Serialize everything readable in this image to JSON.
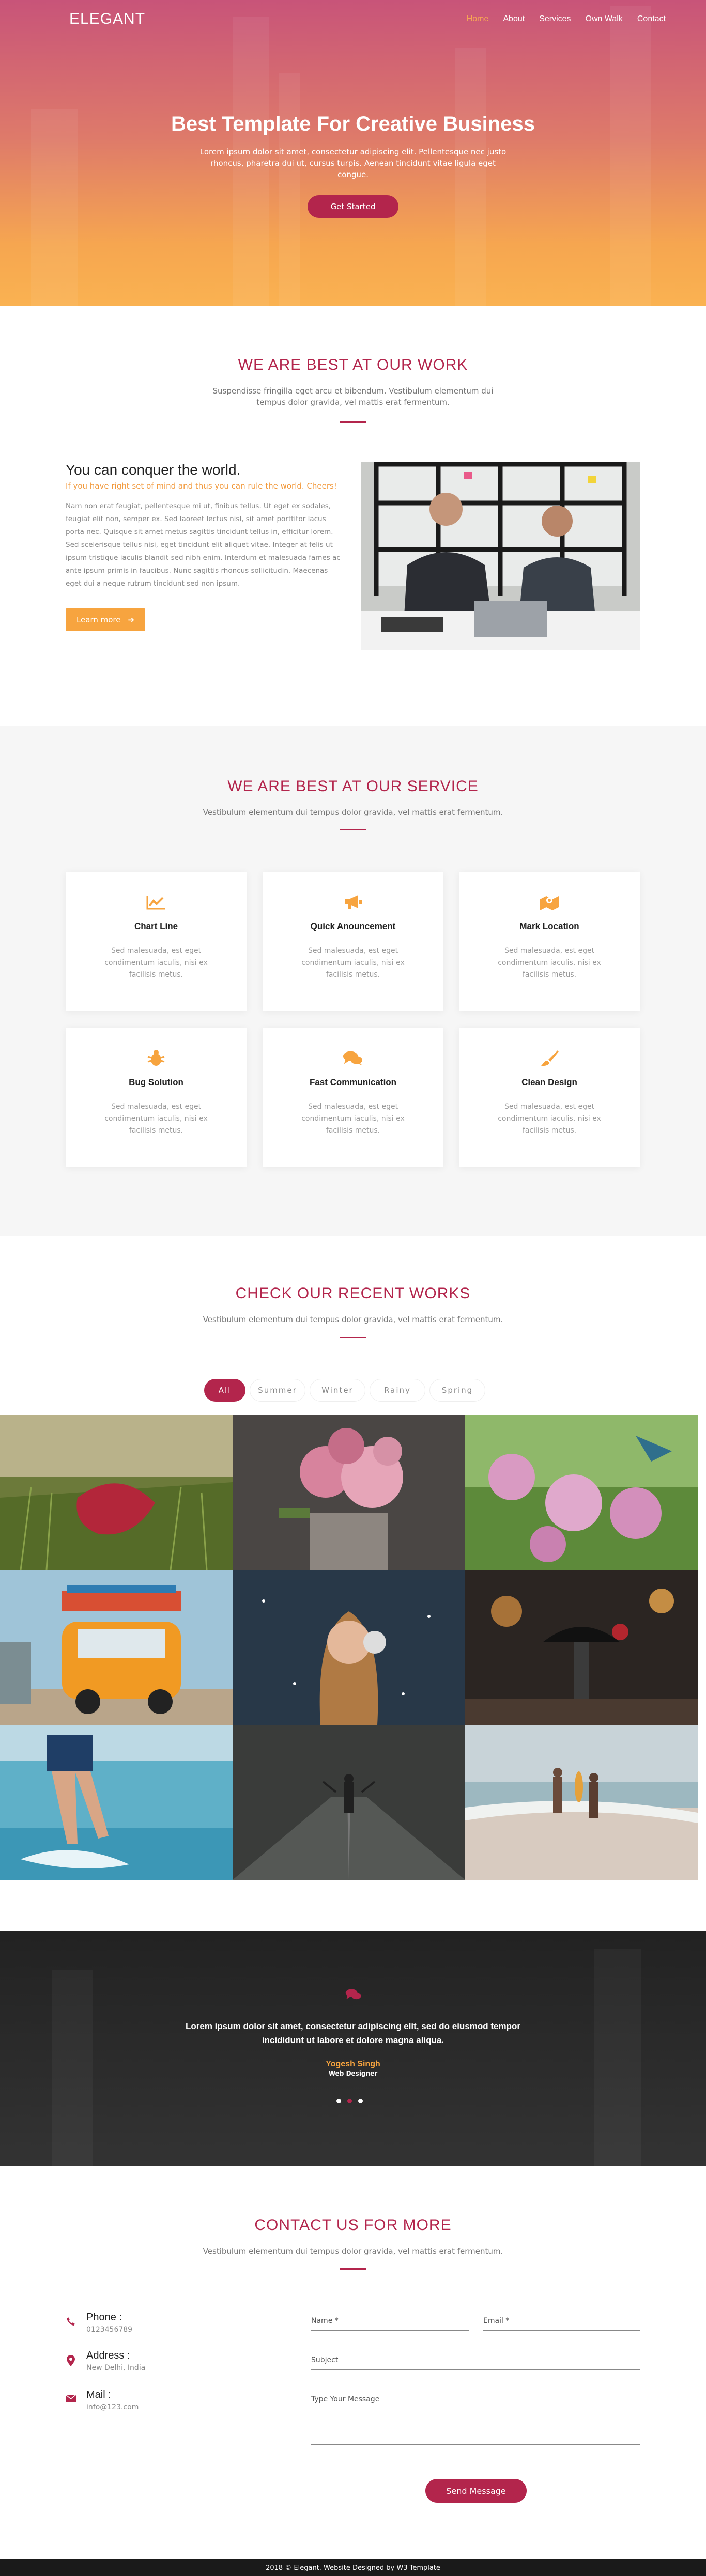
{
  "header": {
    "logo": "ELEGANT",
    "nav": [
      "Home",
      "About",
      "Services",
      "Own Walk",
      "Contact"
    ]
  },
  "hero": {
    "title": "Best Template For Creative Business",
    "text": "Lorem ipsum dolor sit amet, consectetur adipiscing elit. Pellentesque nec justo rhoncus, pharetra dui ut, cursus turpis. Aenean tincidunt vitae ligula eget congue.",
    "button": "Get Started"
  },
  "about": {
    "title": "WE ARE BEST AT OUR WORK",
    "subtitle": "Suspendisse fringilla eget arcu et bibendum. Vestibulum elementum dui tempus dolor gravida, vel mattis erat fermentum.",
    "heading": "You can conquer the world.",
    "tagline": "If you have right set of mind and thus you can rule the world. Cheers!",
    "text": "Nam non erat feugiat, pellentesque mi ut, finibus tellus. Ut eget ex sodales, feugiat elit non, semper ex. Sed laoreet lectus nisl, sit amet porttitor lacus porta nec. Quisque sit amet metus sagittis tincidunt tellus in, efficitur lorem. Sed scelerisque tellus nisi, eget tincidunt elit aliquet vitae. Integer at felis ut ipsum tristique iaculis blandit sed nibh enim. Interdum et malesuada fames ac ante ipsum primis in faucibus. Nunc sagittis rhoncus sollicitudin. Maecenas eget dui a neque rutrum tincidunt sed non ipsum.",
    "button": "Learn more"
  },
  "services": {
    "title": "WE ARE BEST AT OUR SERVICE",
    "subtitle": "Vestibulum elementum dui tempus dolor gravida, vel mattis erat fermentum.",
    "items": [
      {
        "title": "Chart Line",
        "text": "Sed malesuada, est eget condimentum iaculis, nisi ex facilisis metus.",
        "icon": "chart-line-icon"
      },
      {
        "title": "Quick Anouncement",
        "text": "Sed malesuada, est eget condimentum iaculis, nisi ex facilisis metus.",
        "icon": "bullhorn-icon"
      },
      {
        "title": "Mark Location",
        "text": "Sed malesuada, est eget condimentum iaculis, nisi ex facilisis metus.",
        "icon": "map-icon"
      },
      {
        "title": "Bug Solution",
        "text": "Sed malesuada, est eget condimentum iaculis, nisi ex facilisis metus.",
        "icon": "bug-icon"
      },
      {
        "title": "Fast Communication",
        "text": "Sed malesuada, est eget condimentum iaculis, nisi ex facilisis metus.",
        "icon": "comments-icon"
      },
      {
        "title": "Clean Design",
        "text": "Sed malesuada, est eget condimentum iaculis, nisi ex facilisis metus.",
        "icon": "paint-brush-icon"
      }
    ]
  },
  "works": {
    "title": "CHECK OUR RECENT WORKS",
    "subtitle": "Vestibulum elementum dui tempus dolor gravida, vel mattis erat fermentum.",
    "filters": [
      "All",
      "Summer",
      "Winter",
      "Rainy",
      "Spring"
    ]
  },
  "testimonial": {
    "quote": "Lorem ipsum dolor sit amet, consectetur adipiscing elit, sed do eiusmod tempor incididunt ut labore et dolore magna aliqua.",
    "name": "Yogesh Singh",
    "role": "Web Designer"
  },
  "contact": {
    "title": "CONTACT US FOR MORE",
    "subtitle": "Vestibulum elementum dui tempus dolor gravida, vel mattis erat fermentum.",
    "phone_label": "Phone :",
    "phone": "0123456789",
    "address_label": "Address :",
    "address": "New Delhi, India",
    "mail_label": "Mail :",
    "mail": "info@123.com",
    "name_placeholder": "Name *",
    "email_placeholder": "Email *",
    "subject_placeholder": "Subject",
    "message_placeholder": "Type Your Message",
    "button": "Send Message"
  },
  "footer": {
    "text": "2018 © Elegant. Website Designed by W3 Template"
  },
  "colors": {
    "accent": "#b3254c",
    "orange": "#f7a43f"
  }
}
